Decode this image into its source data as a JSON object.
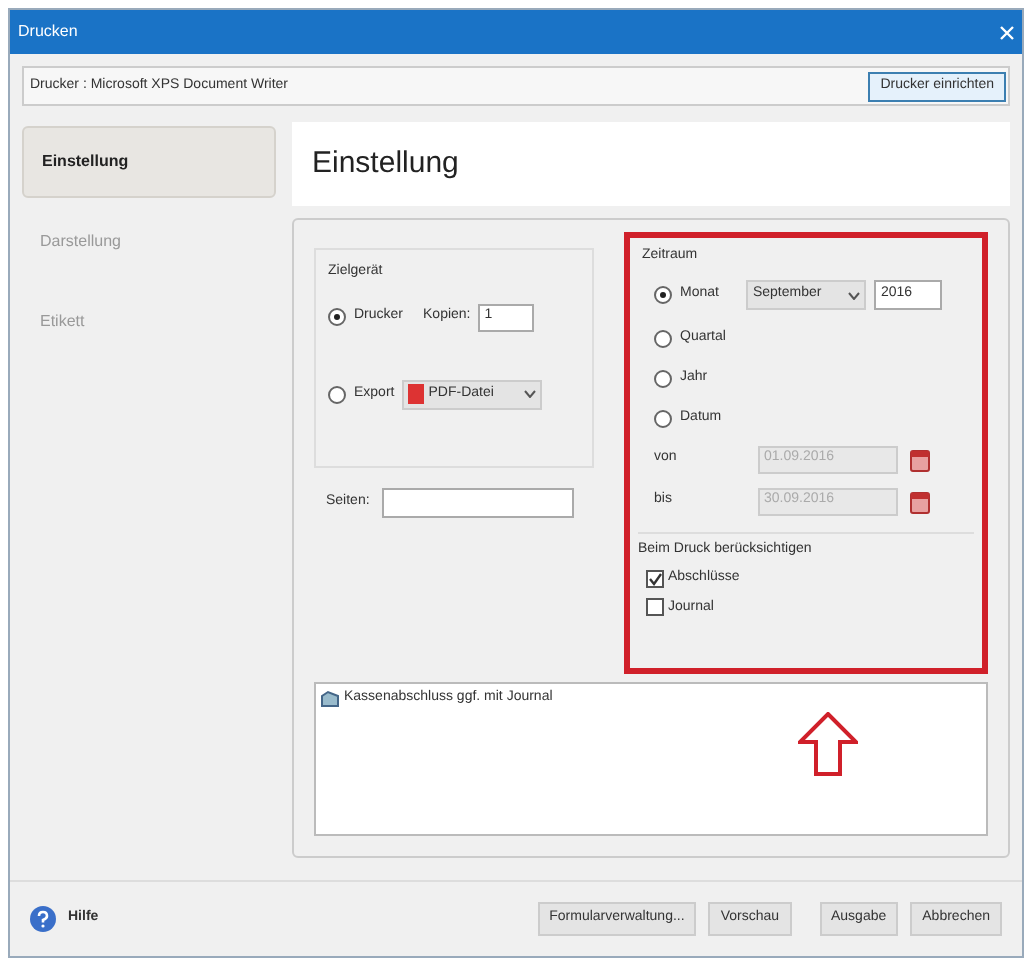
{
  "window": {
    "title": "Drucken"
  },
  "printer": {
    "label": "Drucker : Microsoft XPS Document Writer",
    "button": "Drucker einrichten"
  },
  "sidebar": {
    "items": [
      {
        "label": "Einstellung",
        "selected": true
      },
      {
        "label": "Darstellung",
        "selected": false
      },
      {
        "label": "Etikett",
        "selected": false
      }
    ]
  },
  "heading": "Einstellung",
  "zielgeraet": {
    "title": "Zielgerät",
    "options": [
      {
        "label": "Drucker",
        "selected": true
      },
      {
        "label": "Export",
        "selected": false
      }
    ],
    "copies_label": "Kopien:",
    "copies": "1",
    "export_format": "PDF-Datei",
    "pages_label": "Seiten:"
  },
  "zeitraum": {
    "title": "Zeitraum",
    "options": [
      {
        "label": "Monat",
        "selected": true
      },
      {
        "label": "Quartal",
        "selected": false
      },
      {
        "label": "Jahr",
        "selected": false
      },
      {
        "label": "Datum",
        "selected": false
      }
    ],
    "month": "September",
    "year": "2016",
    "from_label": "von",
    "from": "01.09.2016",
    "to_label": "bis",
    "to": "30.09.2016",
    "dates_disabled": true
  },
  "include": {
    "title": "Beim Druck berücksichtigen",
    "items": [
      {
        "label": "Abschlüsse",
        "checked": true
      },
      {
        "label": "Journal",
        "checked": false
      }
    ]
  },
  "forms": [
    {
      "label": "Kassenabschluss ggf. mit Journal"
    }
  ],
  "help": "Hilfe",
  "buttons": [
    "Formularverwaltung...",
    "Vorschau",
    "Ausgabe",
    "Abbrechen"
  ]
}
